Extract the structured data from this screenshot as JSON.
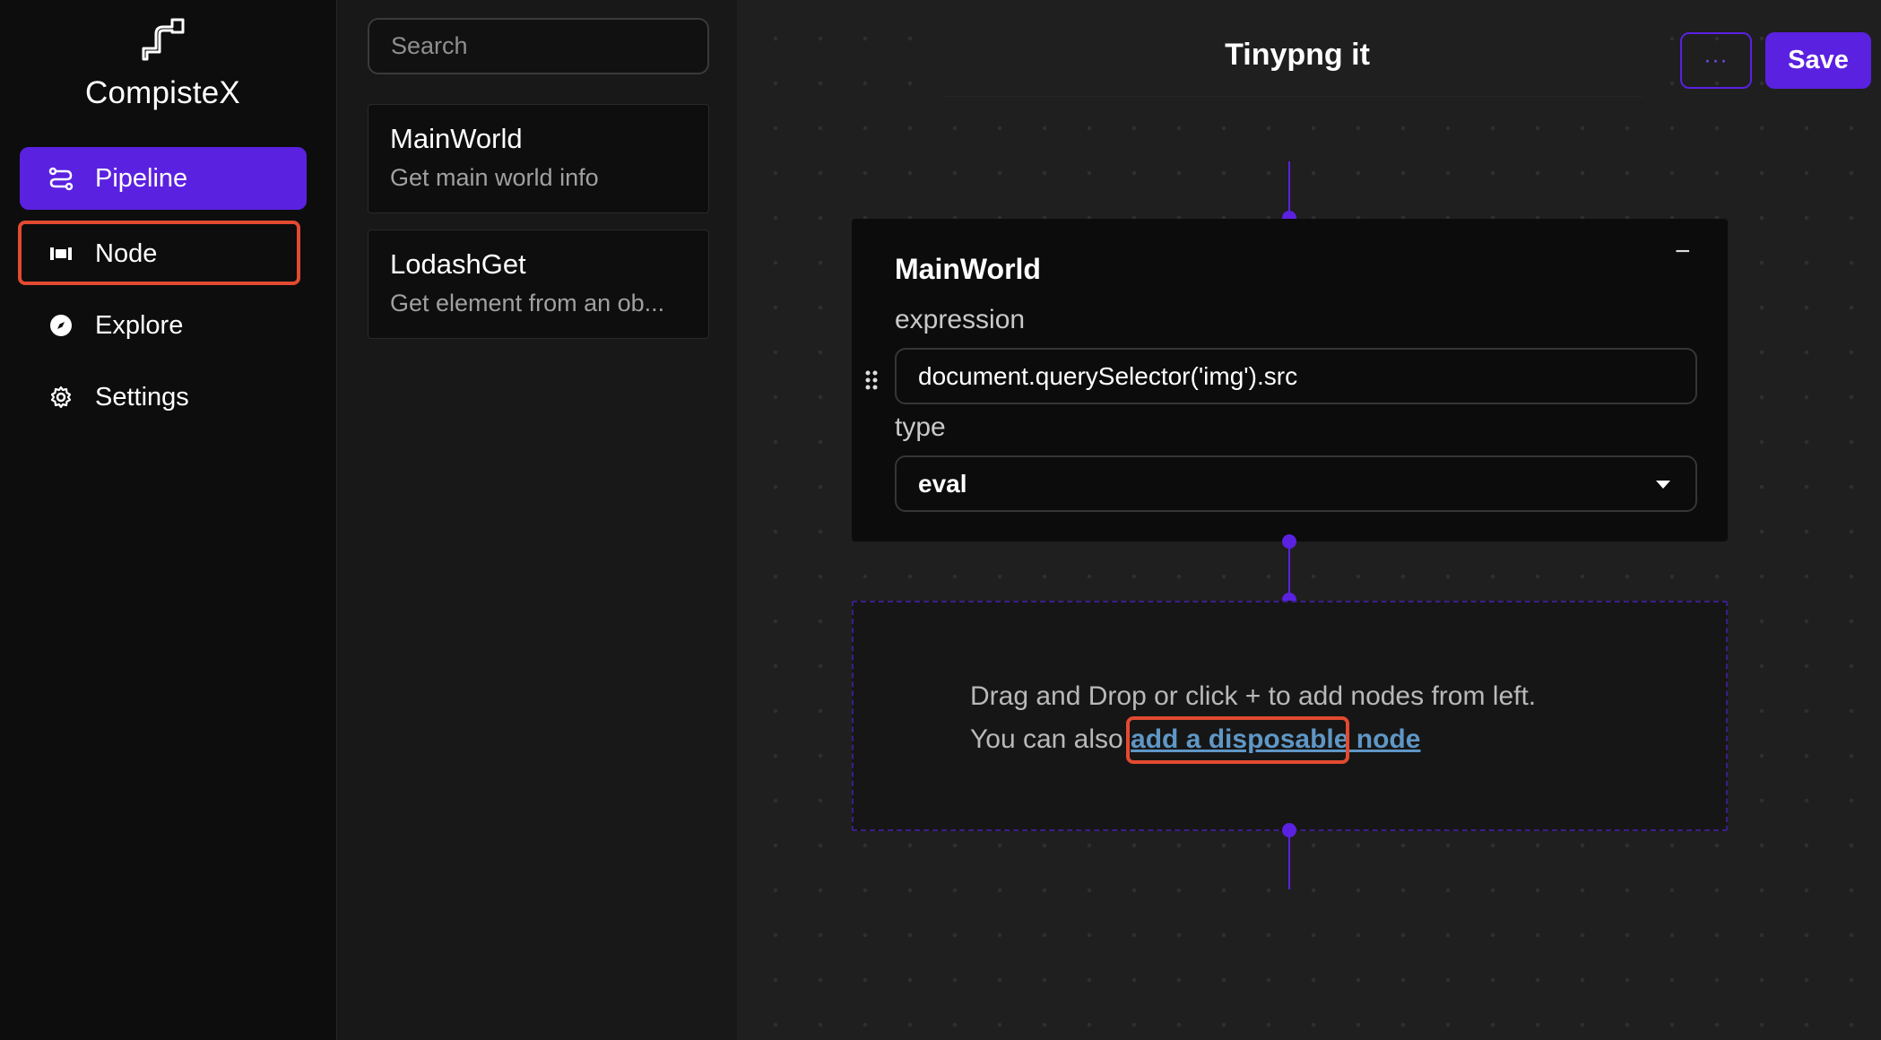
{
  "app": {
    "name": "CompisteX",
    "logo_icon": "pipe-icon"
  },
  "sidebar": {
    "items": [
      {
        "label": "Pipeline",
        "icon": "route-icon",
        "active": true
      },
      {
        "label": "Node",
        "icon": "node-icon",
        "active": false
      },
      {
        "label": "Explore",
        "icon": "compass-icon",
        "active": false
      },
      {
        "label": "Settings",
        "icon": "gear-icon",
        "active": false
      }
    ]
  },
  "node_panel": {
    "search_placeholder": "Search",
    "nodes": [
      {
        "title": "MainWorld",
        "desc": "Get main world info"
      },
      {
        "title": "LodashGet",
        "desc": "Get element from an ob..."
      }
    ]
  },
  "canvas": {
    "pipeline_title": "Tinypng it",
    "more_label": "···",
    "save_label": "Save",
    "node": {
      "title": "MainWorld",
      "collapse_label": "−",
      "expression_label": "expression",
      "expression_value": "document.querySelector('img').src",
      "type_label": "type",
      "type_value": "eval"
    },
    "dropzone": {
      "line1": "Drag and Drop or click + to add nodes from left.",
      "line2_prefix": "You can also",
      "link_label": "add a disposable node"
    }
  },
  "colors": {
    "accent": "#5b21e0",
    "highlight": "#e24a31",
    "link": "#5f97c6"
  }
}
